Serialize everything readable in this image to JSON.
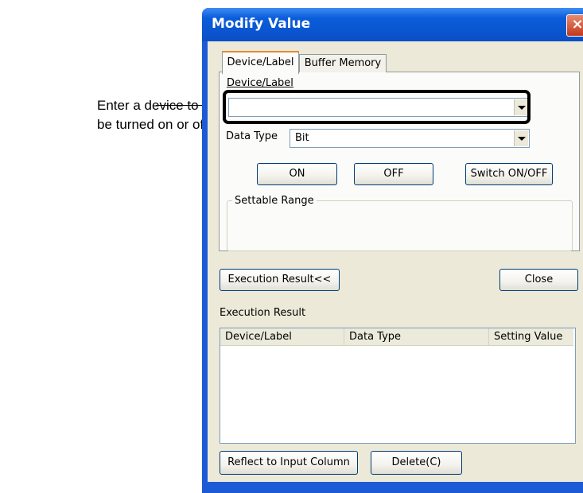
{
  "annotation": {
    "line1": "Enter a device to",
    "line2": "be turned on or off."
  },
  "window": {
    "title": "Modify Value",
    "close_glyph": "×"
  },
  "tabs": [
    {
      "label": "Device/Label",
      "active": true
    },
    {
      "label": "Buffer Memory",
      "active": false
    }
  ],
  "device_field": {
    "label": "Device/Label",
    "value": ""
  },
  "data_type": {
    "label": "Data Type",
    "value": "Bit"
  },
  "buttons": {
    "on": "ON",
    "off": "OFF",
    "switch": "Switch ON/OFF",
    "execution_result": "Execution Result<<",
    "close": "Close",
    "reflect": "Reflect to Input Column",
    "delete": "Delete(C)"
  },
  "settable_range": {
    "label": "Settable Range"
  },
  "execution_result": {
    "label": "Execution Result",
    "columns": [
      "Device/Label",
      "Data Type",
      "Setting Value"
    ],
    "rows": []
  },
  "colors": {
    "titlebar": "#0a55d0",
    "dialog_bg": "#ece9d8",
    "tab_highlight": "#e68b2c"
  }
}
